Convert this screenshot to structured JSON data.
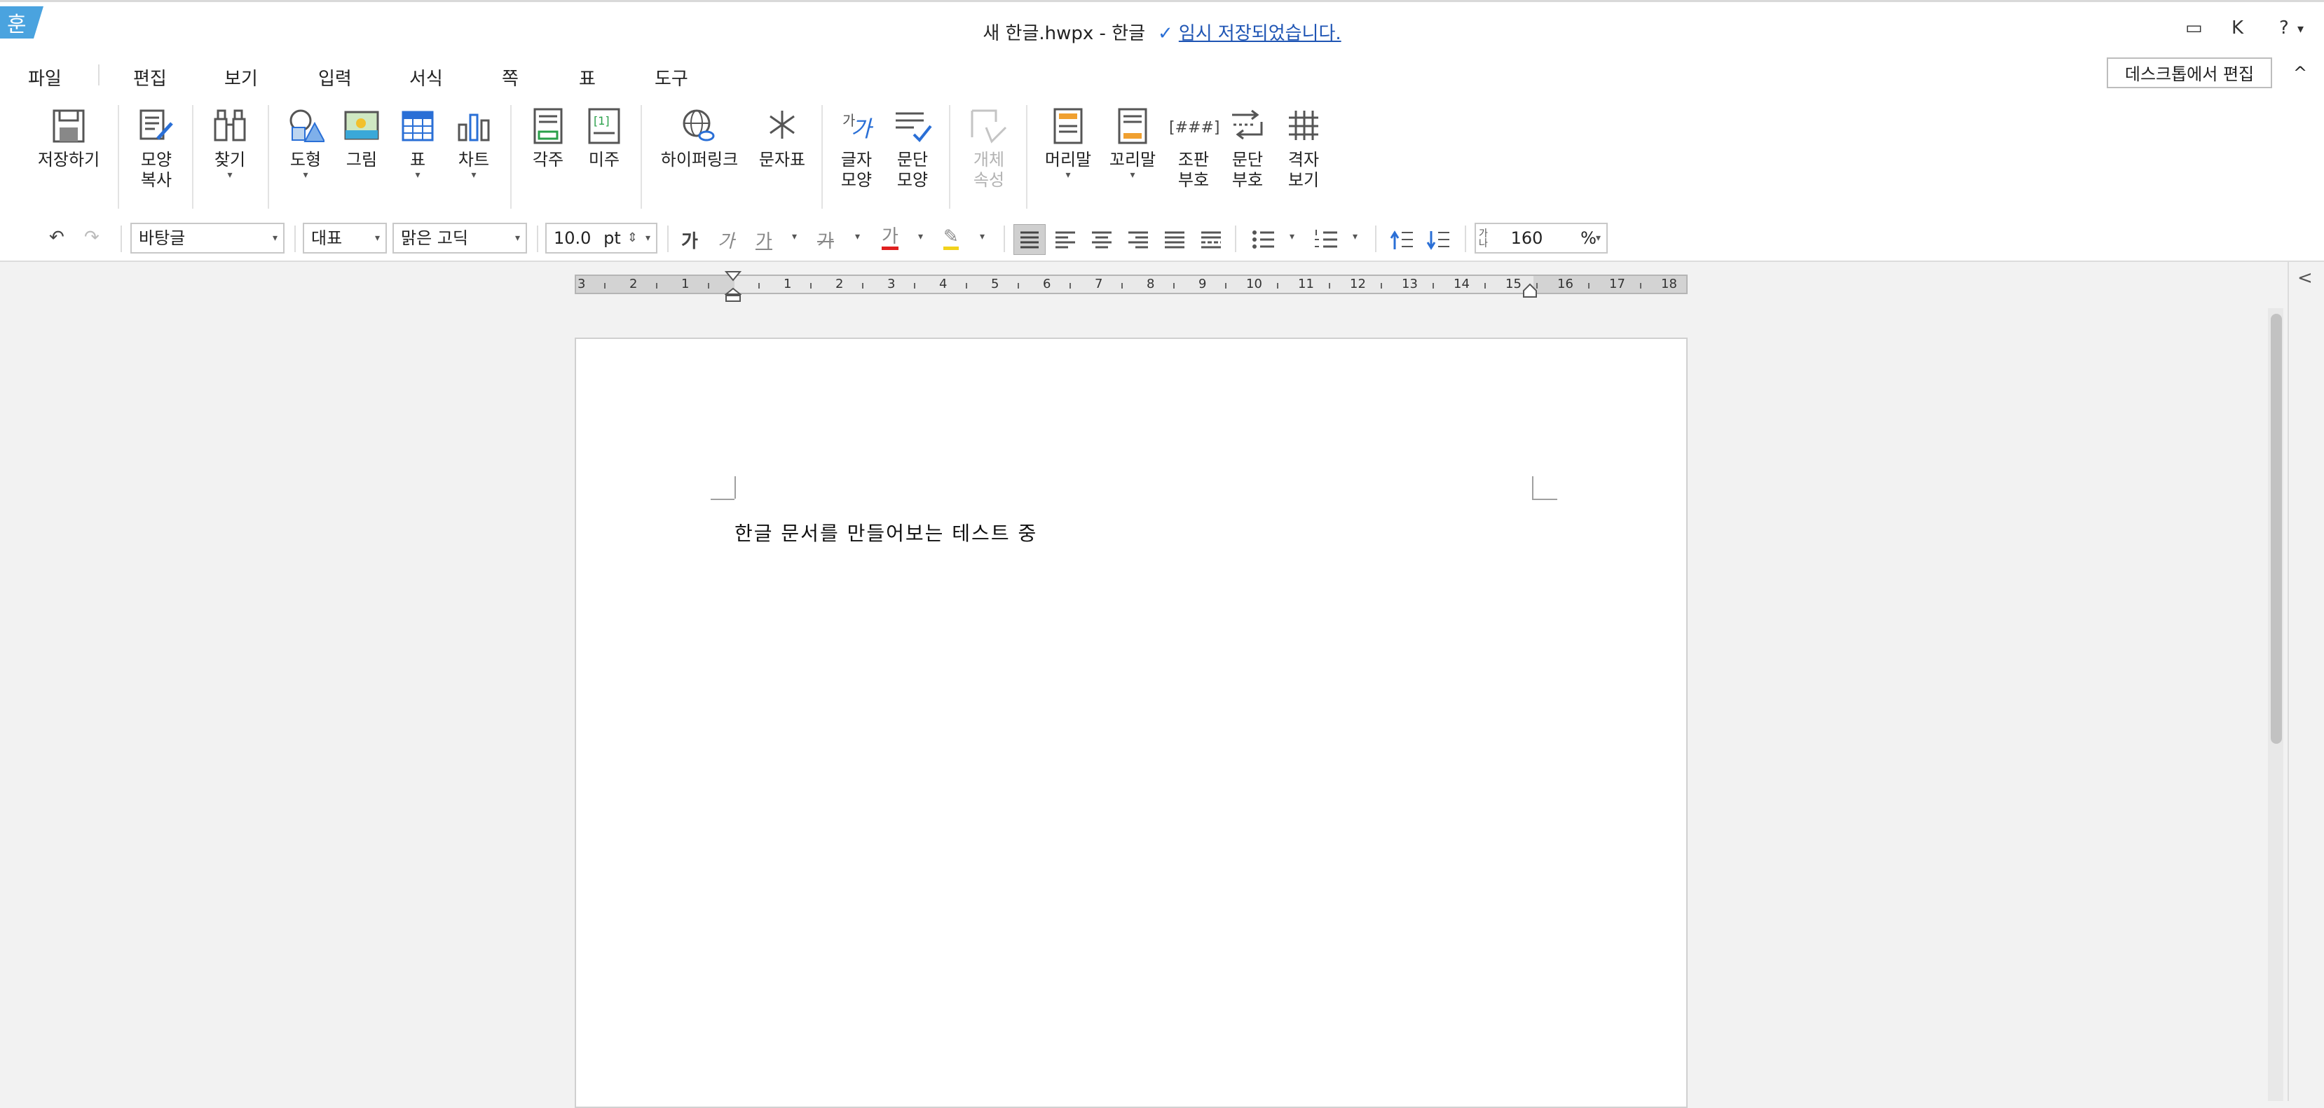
{
  "title": {
    "logo": "훈",
    "doc_name": "새 한글.hwpx - 한글",
    "save_check": "✓",
    "save_status": "임시 저장되었습니다.",
    "comment_icon": "▭",
    "user_initial": "K",
    "help": "?",
    "help_dd": "▾"
  },
  "menu": {
    "items": [
      "파일",
      "편집",
      "보기",
      "입력",
      "서식",
      "쪽",
      "표",
      "도구"
    ],
    "desktop_edit": "데스크톱에서 편집",
    "collapse": "^"
  },
  "ribbon": {
    "save": "저장하기",
    "format_copy_1": "모양",
    "format_copy_2": "복사",
    "find": "찾기",
    "shape": "도형",
    "picture": "그림",
    "table": "표",
    "chart": "차트",
    "footnote": "각주",
    "endnote": "미주",
    "hyperlink": "하이퍼링크",
    "symbol": "문자표",
    "char_shape_1": "글자",
    "char_shape_2": "모양",
    "para_shape_1": "문단",
    "para_shape_2": "모양",
    "obj_prop_1": "개체",
    "obj_prop_2": "속성",
    "header": "머리말",
    "footer": "꼬리말",
    "layout_mark_1": "조판",
    "layout_mark_2": "부호",
    "para_mark_1": "문단",
    "para_mark_2": "부호",
    "grid_1": "격자",
    "grid_2": "보기",
    "glyph_ga": "가",
    "glyph_bracket": "[###]",
    "dropdown": "▾"
  },
  "format": {
    "undo": "↶",
    "redo": "↷",
    "style": "바탕글",
    "lang": "대표",
    "font": "맑은 고딕",
    "size": "10.0",
    "size_unit": "pt",
    "spin": "⇕",
    "bold": "가",
    "italic": "가",
    "underline": "가",
    "strike": "가",
    "font_color": "가",
    "highlight": "✎",
    "line_spacing_icon": "가나",
    "line_spacing": "160",
    "line_spacing_unit": "%",
    "dropdown": "▾"
  },
  "ruler": {
    "left_numbers": [
      "3",
      "2",
      "1"
    ],
    "right_numbers": [
      "1",
      "2",
      "3",
      "4",
      "5",
      "6",
      "7",
      "8",
      "9",
      "10",
      "11",
      "12",
      "13",
      "14",
      "15",
      "16",
      "17",
      "18"
    ]
  },
  "document": {
    "text": "한글 문서를 만들어보는 테스트 중"
  },
  "sidebar": {
    "collapse": "<"
  }
}
